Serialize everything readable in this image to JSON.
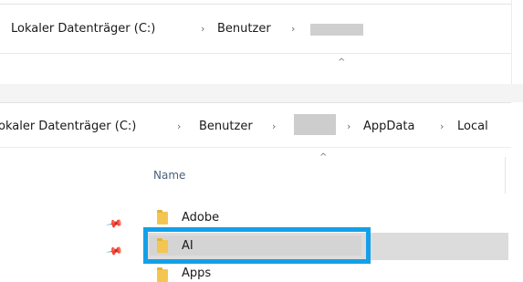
{
  "top_address_bar": {
    "segments": [
      "Lokaler Datenträger (C:)",
      "Benutzer"
    ],
    "separator": "›"
  },
  "bottom_address_bar": {
    "segments": [
      "okaler Datenträger (C:)",
      "Benutzer",
      "AppData",
      "Local"
    ],
    "separator": "›"
  },
  "sort_indicator": "^",
  "file_list": {
    "column_header": "Name",
    "items": [
      {
        "name": "Adobe",
        "icon": "folder-icon",
        "pinned": true
      },
      {
        "name": "AI",
        "icon": "folder-icon",
        "pinned": true,
        "selected": true,
        "highlighted": true
      },
      {
        "name": "Apps",
        "icon": "folder-icon",
        "pinned": false
      }
    ]
  },
  "colors": {
    "highlight": "#13a0e8",
    "selection": "#dcdcdc",
    "folder": "#f2c651",
    "header_text": "#4c607a"
  }
}
